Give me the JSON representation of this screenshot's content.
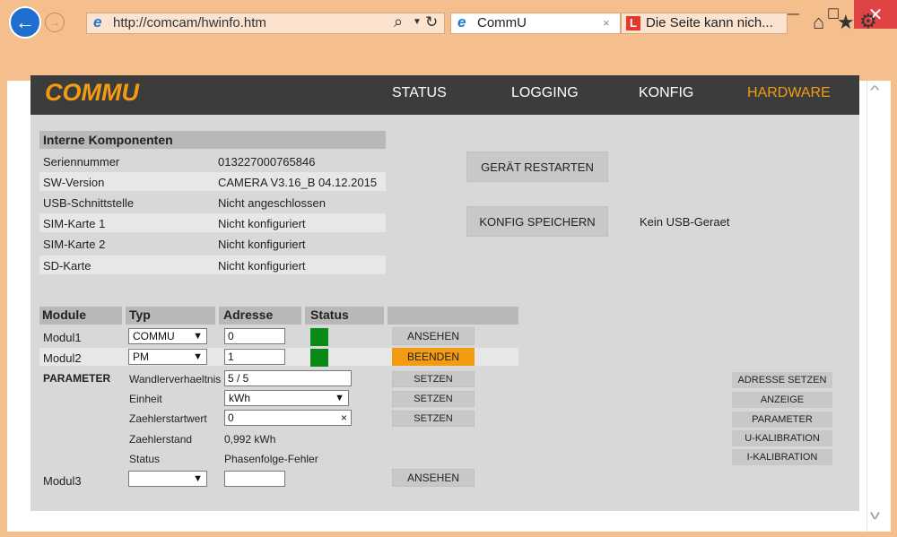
{
  "browser": {
    "url": "http://comcam/hwinfo.htm",
    "tabs": [
      {
        "label": "CommU",
        "close": "×"
      },
      {
        "label": "Die Seite kann nich..."
      }
    ],
    "window_buttons": {
      "minimize": "—",
      "maximize": "☐",
      "close": "✕"
    }
  },
  "app": {
    "logo": "COMMU",
    "nav": [
      "STATUS",
      "LOGGING",
      "KONFIG",
      "HARDWARE"
    ],
    "active_nav": "HARDWARE",
    "accent_color": "#f39c12"
  },
  "internals": {
    "title": "Interne Komponenten",
    "rows": [
      {
        "label": "Seriennummer",
        "value": "013227000765846"
      },
      {
        "label": "SW-Version",
        "value": "CAMERA V3.16_B 04.12.2015"
      },
      {
        "label": "USB-Schnittstelle",
        "value": "Nicht angeschlossen"
      },
      {
        "label": "SIM-Karte 1",
        "value": "Nicht konfiguriert"
      },
      {
        "label": "SIM-Karte 2",
        "value": "Nicht konfiguriert"
      },
      {
        "label": "SD-Karte",
        "value": "Nicht konfiguriert"
      }
    ]
  },
  "actions": {
    "restart": "GERÄT RESTARTEN",
    "save_config": "KONFIG SPEICHERN",
    "usb_status": "Kein USB-Geraet"
  },
  "modules": {
    "headers": {
      "module": "Module",
      "type": "Typ",
      "address": "Adresse",
      "status": "Status"
    },
    "status_ok_color": "#0a8a16",
    "rows": [
      {
        "name": "Modul1",
        "type": "COMMU",
        "address": "0",
        "button": "ANSEHEN"
      },
      {
        "name": "Modul2",
        "type": "PM",
        "address": "1",
        "button": "BEENDEN"
      },
      {
        "name": "Modul3",
        "type": "",
        "address": "",
        "button": "ANSEHEN"
      }
    ],
    "parameter": {
      "title": "PARAMETER",
      "wandler_label": "Wandlerverhaeltnis",
      "wandler_value": "5 / 5",
      "einheit_label": "Einheit",
      "einheit_value": "kWh",
      "start_label": "Zaehlerstartwert",
      "start_value": "0",
      "stand_label": "Zaehlerstand",
      "stand_value": "0,992 kWh",
      "status_label": "Status",
      "status_value": "Phasenfolge-Fehler",
      "set_button": "SETZEN"
    },
    "right_buttons": [
      "ADRESSE SETZEN",
      "ANZEIGE",
      "PARAMETER",
      "U-KALIBRATION",
      "I-KALIBRATION"
    ]
  }
}
